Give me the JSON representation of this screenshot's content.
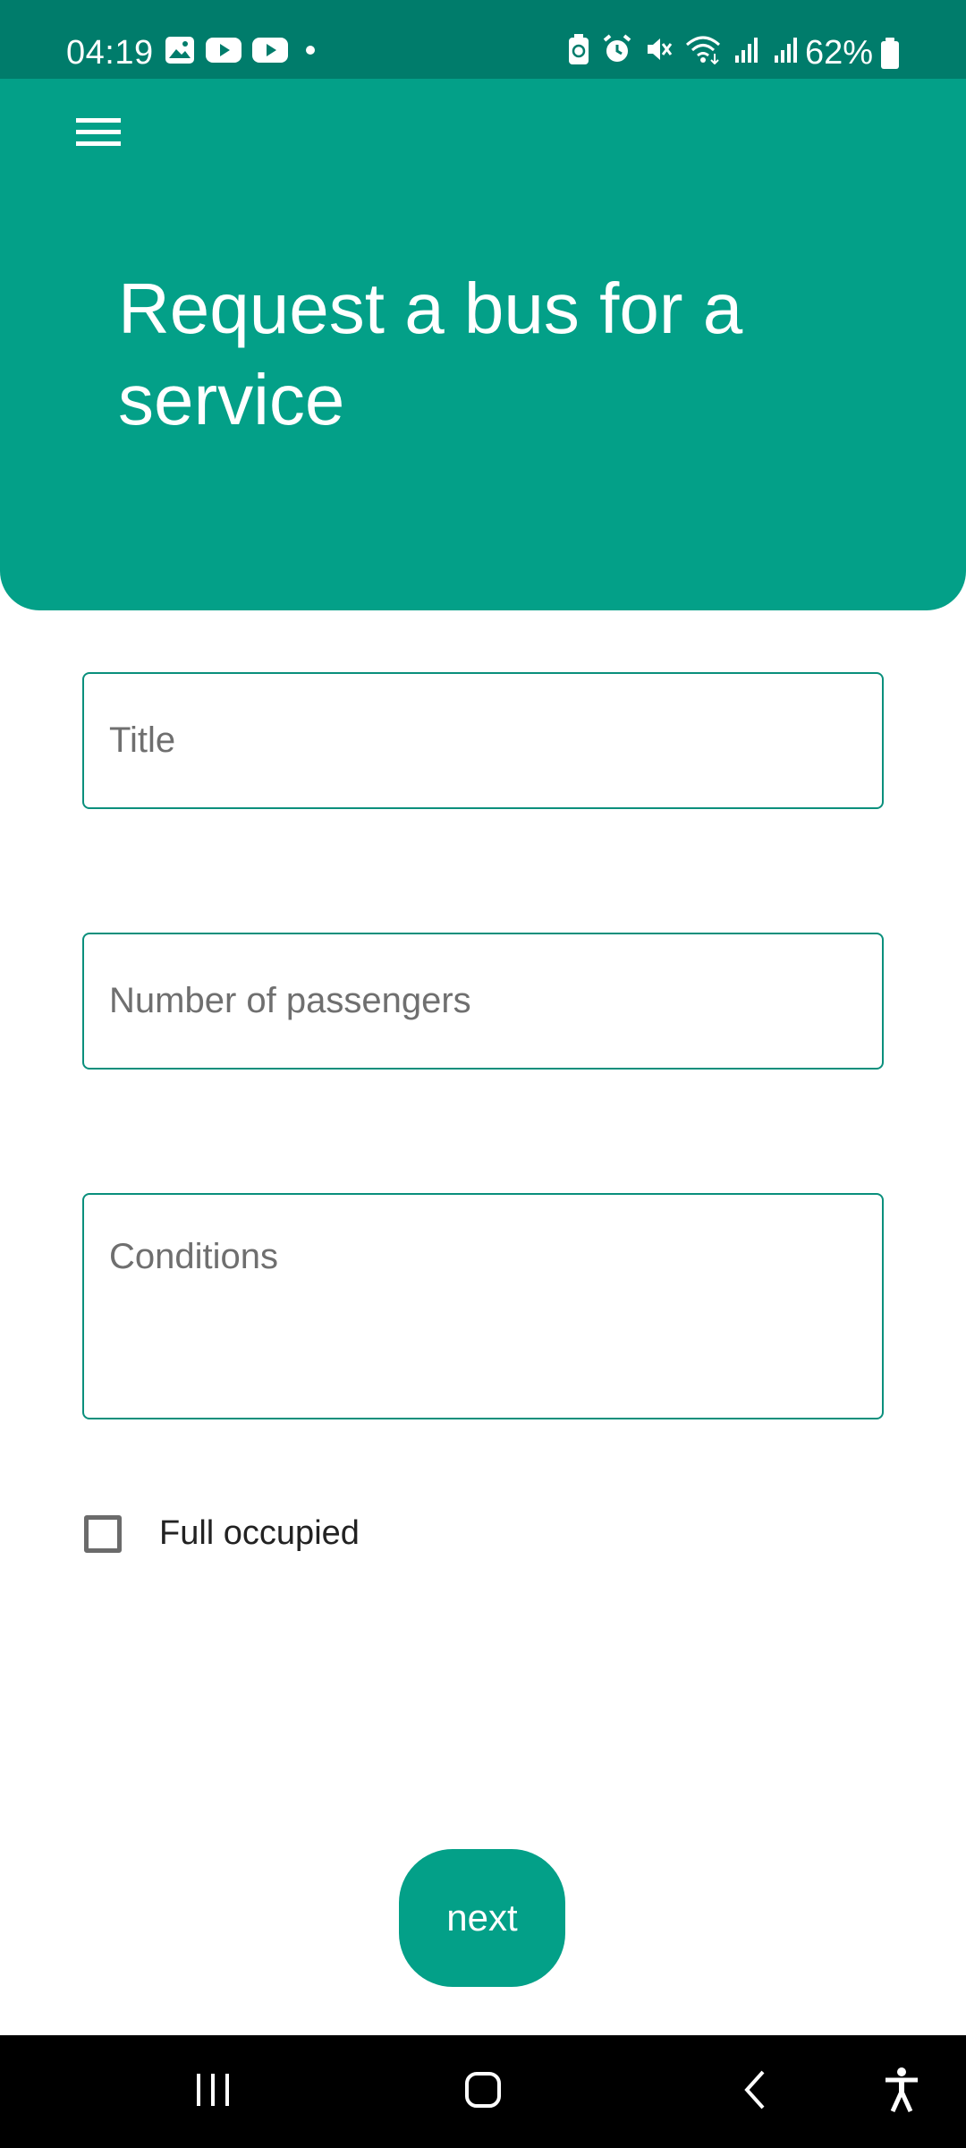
{
  "status_bar": {
    "time": "04:19",
    "battery_percent": "62%",
    "left_icons": [
      "gallery-icon",
      "youtube-icon",
      "youtube-icon",
      "dot-icon"
    ],
    "right_icons": [
      "battery-saver-icon",
      "alarm-icon",
      "mute-icon",
      "wifi-icon",
      "signal-icon",
      "signal-icon"
    ]
  },
  "header": {
    "title": "Request a bus for a service",
    "menu_icon": "hamburger-menu-icon"
  },
  "form": {
    "title_placeholder": "Title",
    "passengers_placeholder": "Number of passengers",
    "conditions_placeholder": "Conditions",
    "full_occupied_label": "Full occupied",
    "full_occupied_checked": false
  },
  "actions": {
    "next_label": "next"
  },
  "nav_bar": {
    "items": [
      "recent-apps-icon",
      "home-icon",
      "back-icon",
      "accessibility-icon"
    ]
  },
  "colors": {
    "status_bar": "#007c6b",
    "primary": "#03a088",
    "field_border": "#0a8f7c",
    "nav_bar": "#000000"
  }
}
